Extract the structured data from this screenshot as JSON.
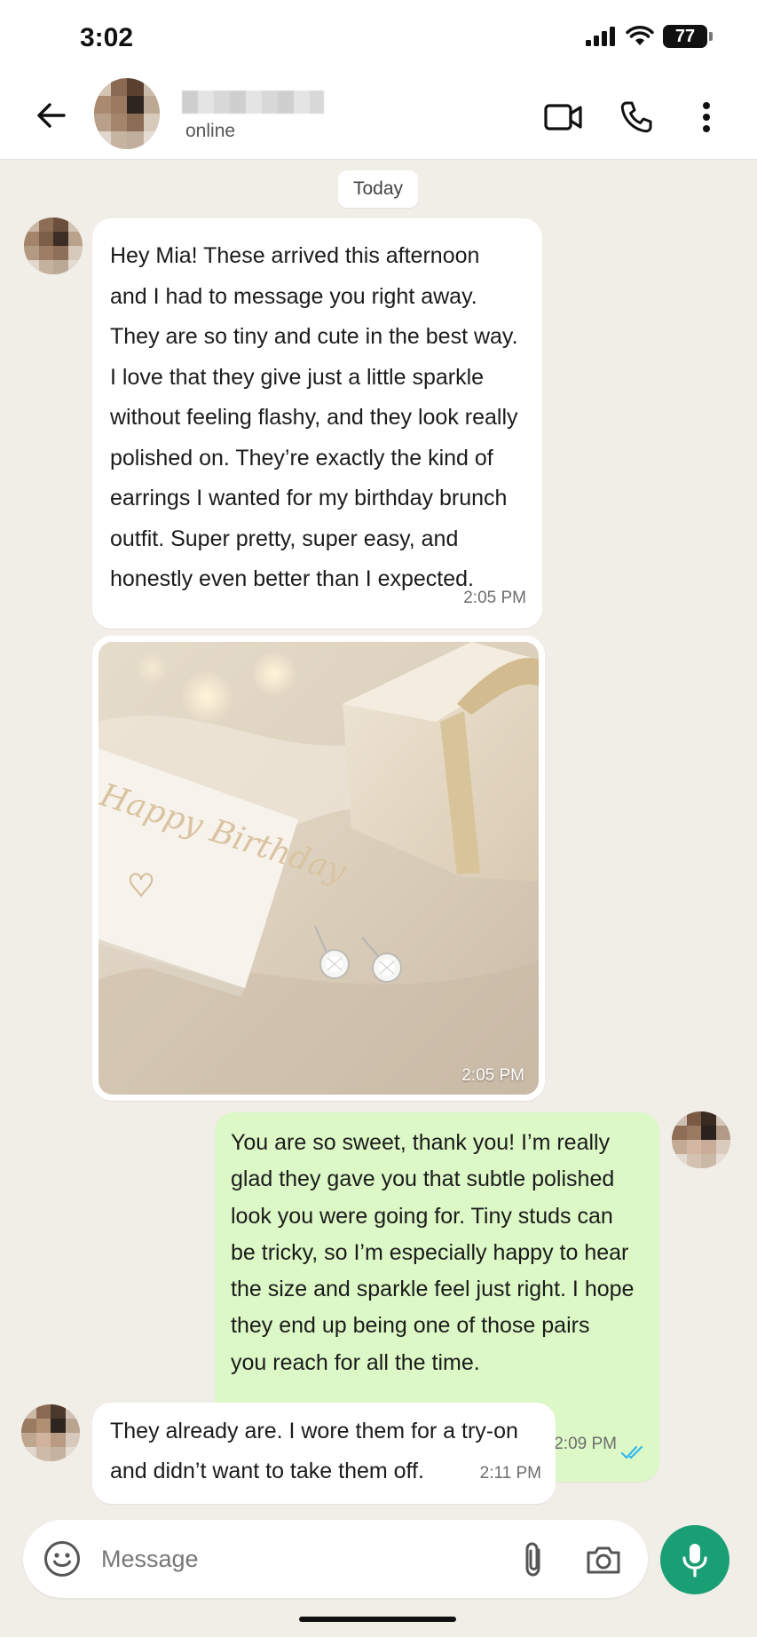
{
  "status_bar": {
    "time": "3:02",
    "battery": "77"
  },
  "header": {
    "contact_status": "online",
    "icons": [
      "back-arrow-icon",
      "video-call-icon",
      "phone-icon",
      "more-vertical-icon"
    ]
  },
  "chat": {
    "date_chip": "Today",
    "messages": [
      {
        "direction": "incoming",
        "text": "Hey Mia! These arrived this afternoon\nand I had to message you right away.\nThey are so tiny and cute in the best way.\nI love that they give just a little sparkle\nwithout feeling flashy, and they look really\npolished on. They’re exactly the kind of\nearrings I wanted for my birthday brunch\noutfit. Super pretty, super easy, and\nhonestly even better than I expected.",
        "time": "2:05 PM"
      },
      {
        "direction": "incoming",
        "type": "photo",
        "photo_caption_text": "Happy Birthday",
        "time": "2:05 PM"
      },
      {
        "direction": "outgoing",
        "text": "You are so sweet, thank you! I’m really\nglad they gave you that subtle polished\nlook you were going for. Tiny studs can\nbe tricky, so I’m especially happy to hear\nthe size and sparkle feel just right. I hope\nthey end up being one of those pairs\nyou reach for all the time.",
        "time": "2:09 PM",
        "read_receipt": "double-check-icon"
      },
      {
        "direction": "incoming",
        "text": "They already are. I wore them for a try-on\nand didn’t want to take them off.",
        "time": "2:11 PM"
      }
    ]
  },
  "input_bar": {
    "placeholder": "Message",
    "icons": [
      "emoji-icon",
      "attachment-icon",
      "camera-icon",
      "microphone-icon"
    ]
  },
  "colors": {
    "chat_background": "#f1eee8",
    "outgoing_bubble": "#dcf8c6",
    "incoming_bubble": "#ffffff",
    "mic_button": "#1a9e74",
    "read_receipt": "#34b7f1"
  }
}
